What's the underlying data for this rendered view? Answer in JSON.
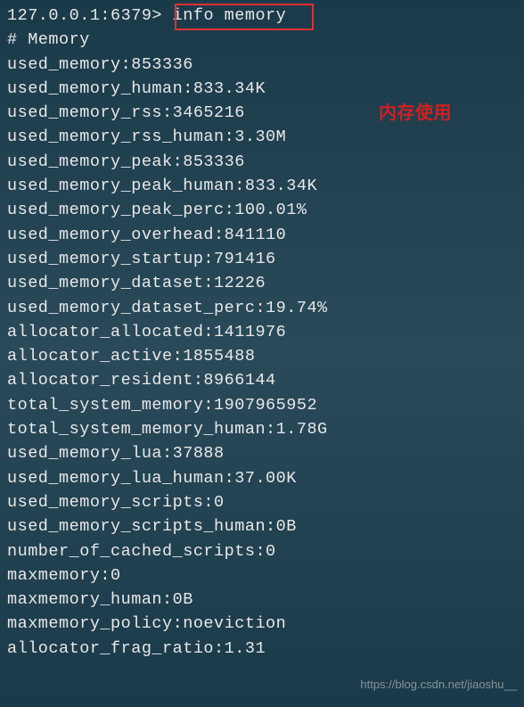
{
  "prompt": "127.0.0.1:6379> ",
  "command": "info memory",
  "section_header": "# Memory",
  "lines": [
    "used_memory:853336",
    "used_memory_human:833.34K",
    "used_memory_rss:3465216",
    "used_memory_rss_human:3.30M",
    "used_memory_peak:853336",
    "used_memory_peak_human:833.34K",
    "used_memory_peak_perc:100.01%",
    "used_memory_overhead:841110",
    "used_memory_startup:791416",
    "used_memory_dataset:12226",
    "used_memory_dataset_perc:19.74%",
    "allocator_allocated:1411976",
    "allocator_active:1855488",
    "allocator_resident:8966144",
    "total_system_memory:1907965952",
    "total_system_memory_human:1.78G",
    "used_memory_lua:37888",
    "used_memory_lua_human:37.00K",
    "used_memory_scripts:0",
    "used_memory_scripts_human:0B",
    "number_of_cached_scripts:0",
    "maxmemory:0",
    "maxmemory_human:0B",
    "maxmemory_policy:noeviction",
    "allocator_frag_ratio:1.31"
  ],
  "annotation_label": "内存使用",
  "watermark": "https://blog.csdn.net/jiaoshu__"
}
